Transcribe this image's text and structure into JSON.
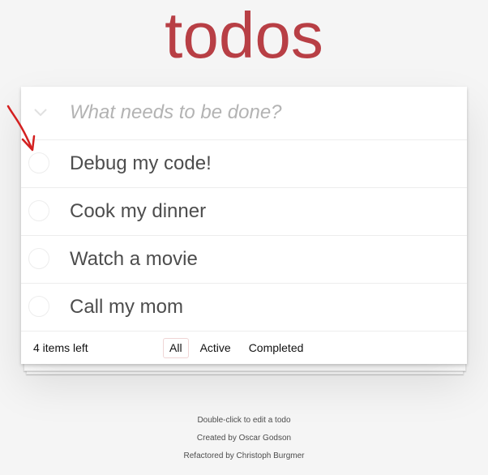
{
  "app": {
    "title": "todos"
  },
  "new_todo": {
    "placeholder": "What needs to be done?",
    "value": ""
  },
  "todos": [
    {
      "label": "Debug my code!",
      "completed": false
    },
    {
      "label": "Cook my dinner",
      "completed": false
    },
    {
      "label": "Watch a movie",
      "completed": false
    },
    {
      "label": "Call my mom",
      "completed": false
    }
  ],
  "footer": {
    "count_text": "4 items left",
    "filters": [
      {
        "label": "All",
        "selected": true
      },
      {
        "label": "Active",
        "selected": false
      },
      {
        "label": "Completed",
        "selected": false
      }
    ]
  },
  "info": {
    "line1": "Double-click to edit a todo",
    "line2": "Created by Oscar Godson",
    "line3": "Refactored by Christoph Burgmer"
  },
  "colors": {
    "title": "#b83f45",
    "background": "#f5f5f5",
    "annotation_arrow": "#d42020"
  },
  "icons": {
    "toggle_all": "chevron-down-icon",
    "annotation": "red-arrow-annotation-icon"
  }
}
